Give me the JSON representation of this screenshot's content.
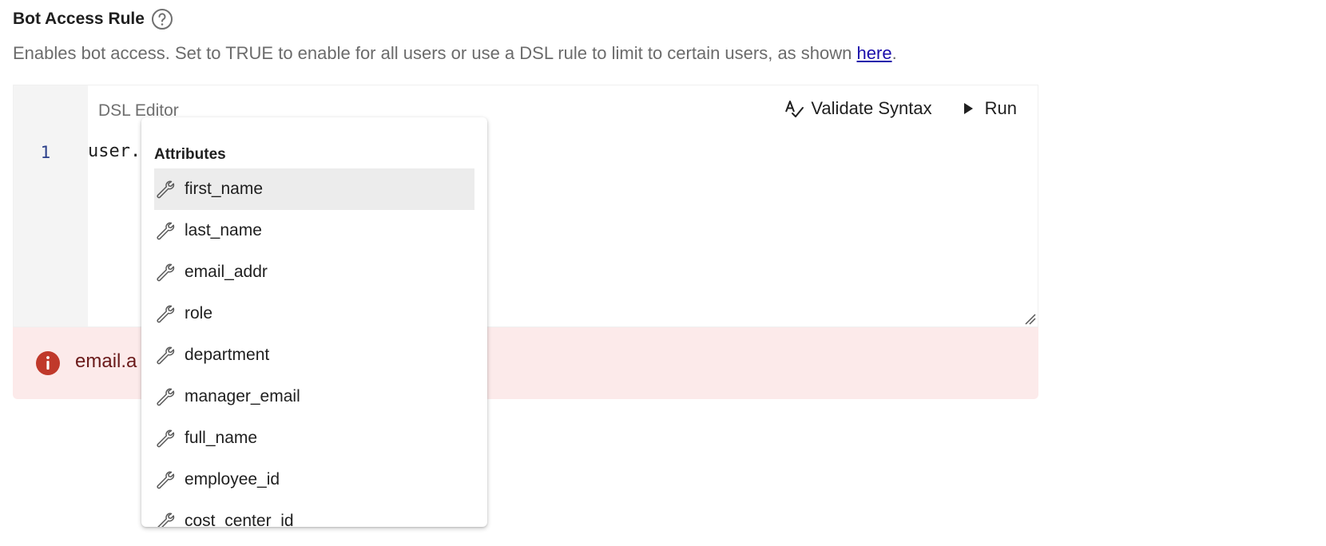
{
  "header": {
    "title": "Bot Access Rule",
    "help_icon": "question-circle-icon",
    "description_prefix": "Enables bot access. Set to TRUE to enable for all users or use a DSL rule to limit to certain users, as shown ",
    "description_link": "here",
    "description_suffix": "."
  },
  "editor": {
    "label": "DSL Editor",
    "line_number": "1",
    "code": "user.",
    "validate_label": "Validate Syntax",
    "validate_icon": "spellcheck-icon",
    "run_label": "Run",
    "run_icon": "play-icon"
  },
  "error": {
    "icon": "error-icon",
    "color": "#c0392b",
    "text": "email.a"
  },
  "autocomplete": {
    "header": "Attributes",
    "item_icon": "wrench-icon",
    "selected_index": 0,
    "items": [
      {
        "label": "first_name"
      },
      {
        "label": "last_name"
      },
      {
        "label": "email_addr"
      },
      {
        "label": "role"
      },
      {
        "label": "department"
      },
      {
        "label": "manager_email"
      },
      {
        "label": "full_name"
      },
      {
        "label": "employee_id"
      },
      {
        "label": "cost_center_id"
      }
    ]
  }
}
